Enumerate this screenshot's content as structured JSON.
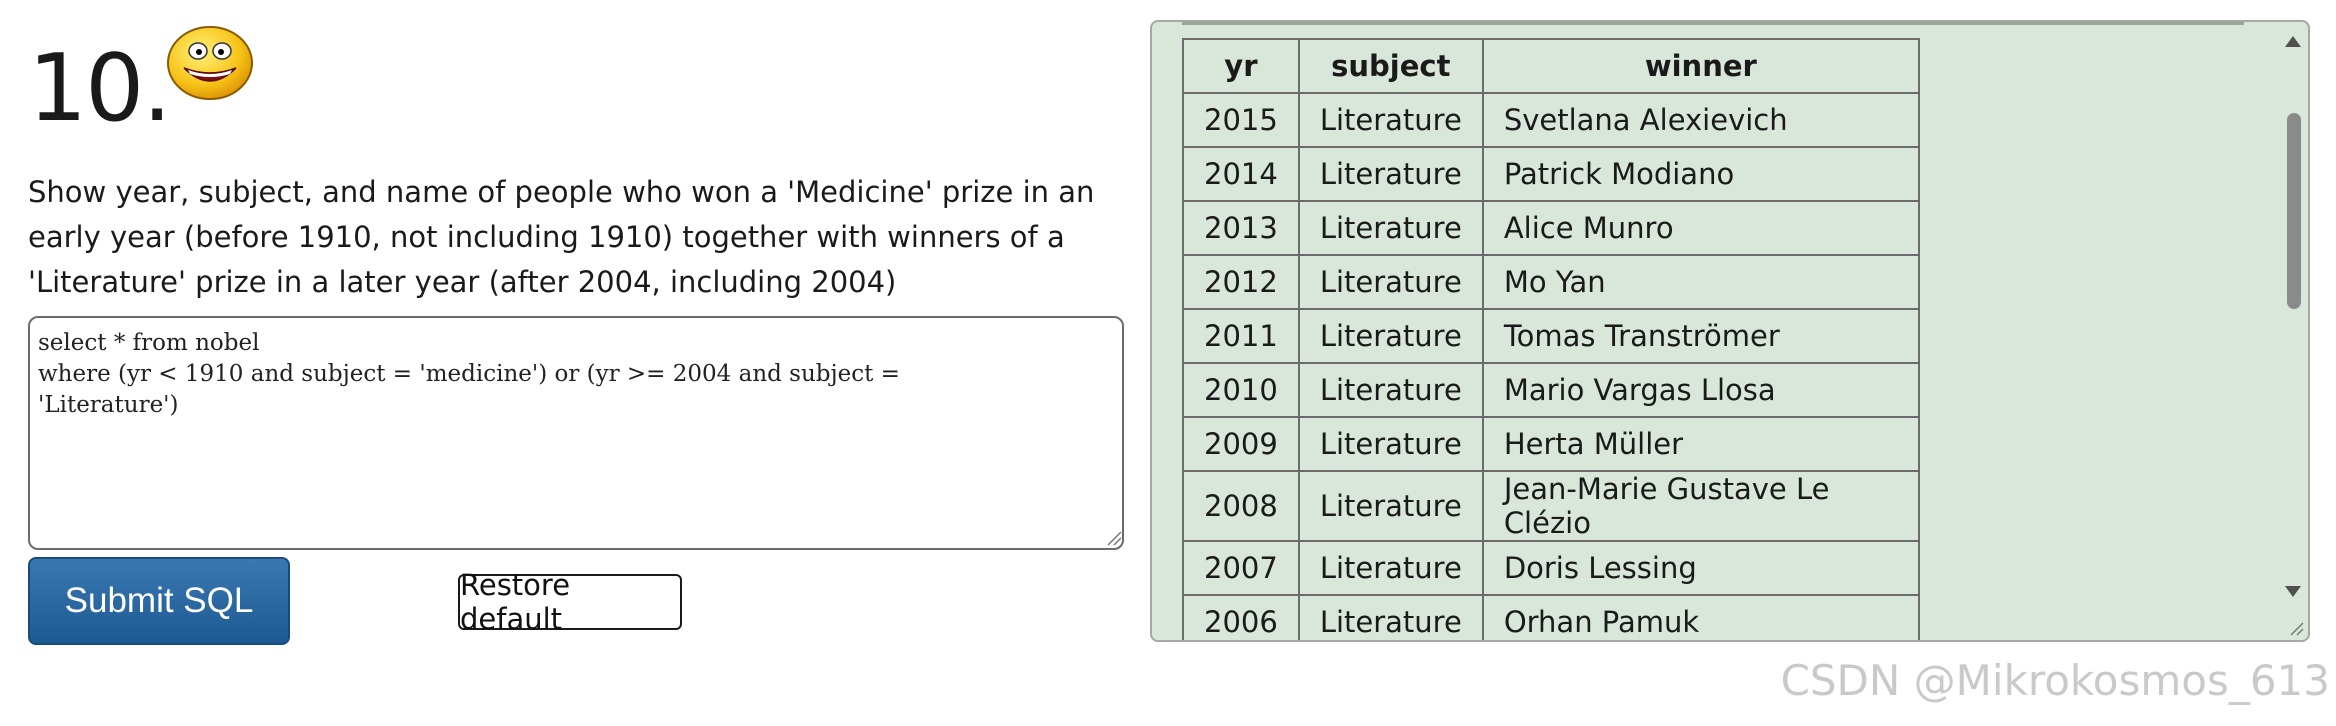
{
  "question": {
    "number": "10.",
    "icon": "smiley-face-icon",
    "text": "Show year, subject, and name of people who won a 'Medicine' prize in an early year (before 1910, not including 1910) together with winners of a 'Literature' prize in a later year (after 2004, including 2004)"
  },
  "editor": {
    "sql": "select * from nobel\nwhere (yr < 1910 and subject = 'medicine') or (yr >= 2004 and subject =\n'Literature')"
  },
  "buttons": {
    "submit_label": "Submit SQL",
    "restore_label": "Restore default"
  },
  "results": {
    "columns": [
      "yr",
      "subject",
      "winner"
    ],
    "rows": [
      {
        "yr": "2015",
        "subject": "Literature",
        "winner": "Svetlana Alexievich"
      },
      {
        "yr": "2014",
        "subject": "Literature",
        "winner": "Patrick Modiano"
      },
      {
        "yr": "2013",
        "subject": "Literature",
        "winner": "Alice Munro"
      },
      {
        "yr": "2012",
        "subject": "Literature",
        "winner": "Mo Yan"
      },
      {
        "yr": "2011",
        "subject": "Literature",
        "winner": "Tomas Tranströmer"
      },
      {
        "yr": "2010",
        "subject": "Literature",
        "winner": "Mario Vargas Llosa"
      },
      {
        "yr": "2009",
        "subject": "Literature",
        "winner": "Herta Müller"
      },
      {
        "yr": "2008",
        "subject": "Literature",
        "winner": "Jean-Marie Gustave Le Clézio"
      },
      {
        "yr": "2007",
        "subject": "Literature",
        "winner": "Doris Lessing"
      },
      {
        "yr": "2006",
        "subject": "Literature",
        "winner": "Orhan Pamuk"
      }
    ]
  },
  "watermark": "CSDN @Mikrokosmos_613",
  "colors": {
    "results_bg": "#d9e6da",
    "submit_bg": "#2a6aa6"
  }
}
